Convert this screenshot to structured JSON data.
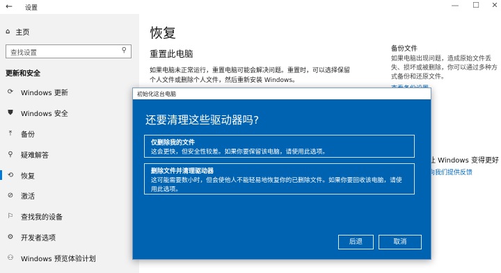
{
  "window": {
    "title": "设置",
    "back_icon": "←",
    "minimize": "—",
    "maximize": "☐",
    "close": "✕"
  },
  "sidebar": {
    "home_label": "主页",
    "search_placeholder": "查找设置",
    "section_title": "更新和安全",
    "items": [
      {
        "icon": "⟳",
        "label": "Windows 更新"
      },
      {
        "icon": "⛊",
        "label": "Windows 安全"
      },
      {
        "icon": "⤒",
        "label": "备份"
      },
      {
        "icon": "⚲",
        "label": "疑难解答"
      },
      {
        "icon": "⟲",
        "label": "恢复"
      },
      {
        "icon": "⊘",
        "label": "激活"
      },
      {
        "icon": "⚐",
        "label": "查找我的设备"
      },
      {
        "icon": "⚙",
        "label": "开发者选项"
      },
      {
        "icon": "⚇",
        "label": "Windows 预览体验计划"
      }
    ]
  },
  "main": {
    "title": "恢复",
    "subheading": "重置此电脑",
    "description": "如果电脑未正常运行，重置电脑可能会解决问题。重置时，可以选择保留个人文件或删除个人文件，然后重新安装 Windows。",
    "side_title": "备份文件",
    "side_description": "如果电脑出现问题，造成原始文件丢失、损坏或被删除，你可以通过多种方式备份和还原文件。",
    "side_link": "查看备份设置",
    "side_frag1": "让 Windows 变得更好",
    "side_frag2": "向我们提供反馈"
  },
  "dialog": {
    "window_title": "初始化这台电脑",
    "heading": "还要清理这些驱动器吗?",
    "option1_title": "仅删除我的文件",
    "option1_desc": "这会更快，但安全性较差。如果你要保留该电脑，请使用此选项。",
    "option2_title": "删除文件并清理驱动器",
    "option2_desc": "这可能需要数小时，但会使他人不能轻易地恢复你的已删除文件。如果你要回收该电脑，请使用此选项。",
    "back_label": "后退",
    "cancel_label": "取消"
  },
  "colors": {
    "dialog_bg": "#0063b1",
    "accent": "#0078d7",
    "sidebar_bg": "#f2f2f2"
  }
}
